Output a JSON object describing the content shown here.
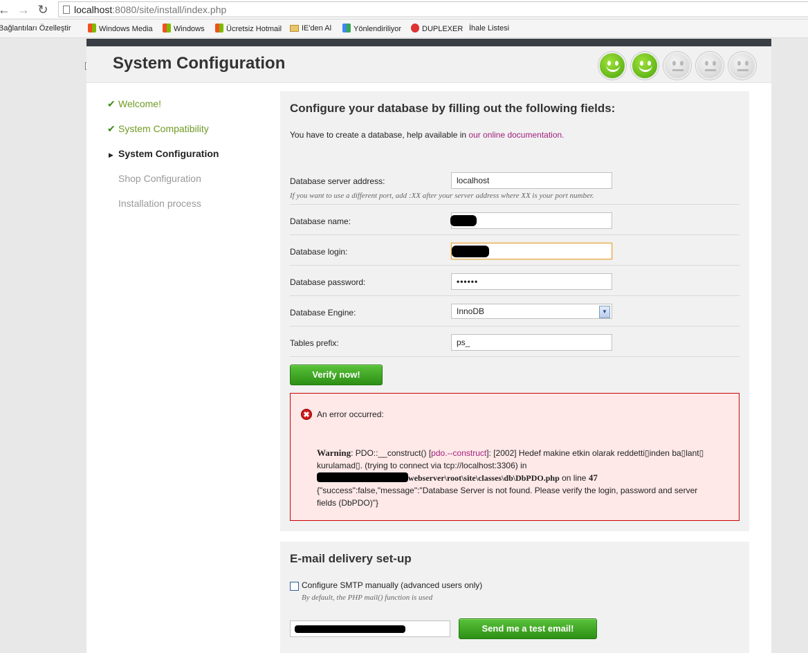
{
  "browser": {
    "url_host": "localhost",
    "url_port": ":8080",
    "url_path": "/site/install/index.php",
    "bookmarks": [
      "Bağlantıları Özelleştir",
      "Windows Media",
      "Windows",
      "Ücretsiz Hotmail",
      "IE'den Al",
      "Yönlendiriliyor",
      "DUPLEXER",
      "İhale Listesi"
    ]
  },
  "header": {
    "title": "System Configuration",
    "progress": {
      "completed": 2,
      "total": 5
    }
  },
  "sidebar": {
    "steps": [
      {
        "label": "Welcome!",
        "state": "done"
      },
      {
        "label": "System Compatibility",
        "state": "done"
      },
      {
        "label": "System Configuration",
        "state": "current"
      },
      {
        "label": "Shop Configuration",
        "state": "todo"
      },
      {
        "label": "Installation process",
        "state": "todo"
      }
    ]
  },
  "database": {
    "heading": "Configure your database by filling out the following fields:",
    "intro": "You have to create a database, help available in ",
    "intro_link": "our online documentation.",
    "server_label": "Database server address:",
    "server_value": "localhost",
    "server_hint": "If you want to use a different port, add :XX after your server address where XX is your port number.",
    "name_label": "Database name:",
    "login_label": "Database login:",
    "password_label": "Database password:",
    "password_value": "••••••",
    "engine_label": "Database Engine:",
    "engine_value": "InnoDB",
    "prefix_label": "Tables prefix:",
    "prefix_value": "ps_",
    "verify_button": "Verify now!"
  },
  "error": {
    "title": "An error occurred:",
    "warning_label": "Warning",
    "text_1": ": PDO::__construct() [",
    "pdo_link": "pdo.--construct",
    "text_2": "]: [2002] Hedef makine etkin olarak reddetti▯inden ba▯lant▯ kurulamad▯. (trying to connect via tcp://localhost:3306) in",
    "file_path": "webserver\\root\\site\\classes\\db\\DbPDO.php",
    "on_line": " on line ",
    "line_number": "47",
    "json_message": "{\"success\":false,\"message\":\"Database Server is not found. Please verify the login, password and server fields (DbPDO)\"}"
  },
  "email": {
    "heading": "E-mail delivery set-up",
    "smtp_label": "Configure SMTP manually (advanced users only)",
    "smtp_hint": "By default, the PHP mail() function is used",
    "test_button": "Send me a test email!"
  },
  "colors": {
    "accent_green": "#3b8b13",
    "link_purple": "#a0207d",
    "error_red": "#cc0000"
  }
}
